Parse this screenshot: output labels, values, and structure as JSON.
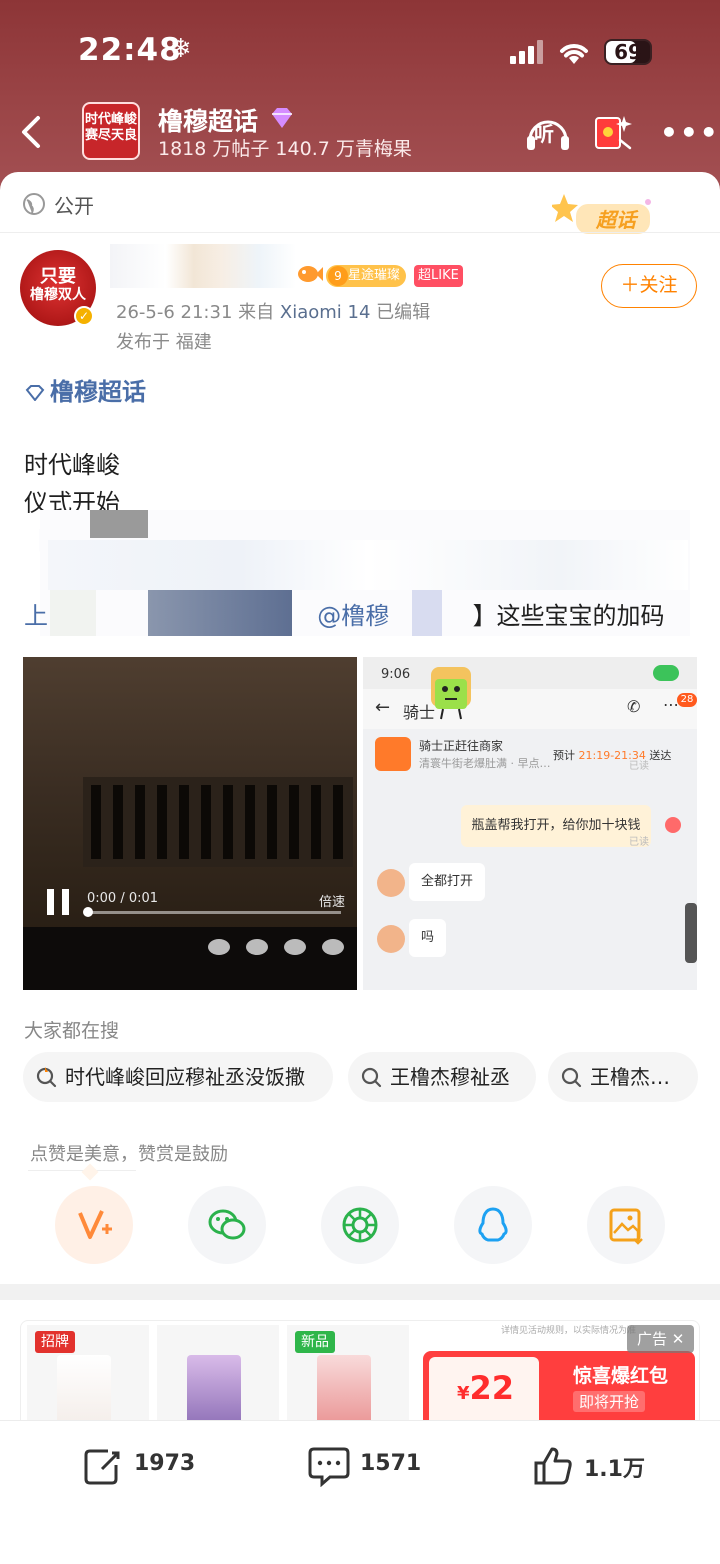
{
  "status_bar": {
    "time": "22:48",
    "battery": "69",
    "battery_level": 0.69
  },
  "header": {
    "logo_text_1": "时代峰峻",
    "logo_text_2": "赛尽天良",
    "title": "橹穆超话",
    "subtitle": "1818 万帖子 140.7 万青梅果",
    "listen_label": "听"
  },
  "post": {
    "visibility": "公开",
    "badge_text": "超话",
    "avatar_text_1": "只要",
    "avatar_text_2": "橹穆双人",
    "level_num": "9",
    "level_label": "星途璀璨",
    "like_badge": "超LIKE",
    "time": "26-5-6 21:31",
    "source_prefix": "来自",
    "device": "Xiaomi 14",
    "edited": "已编辑",
    "location": "发布于 福建",
    "follow_label": "＋关注",
    "topic": "橹穆超话",
    "line1": "时代峰峻",
    "line2": "仪式开始",
    "line3_start": "【@",
    "line5_start": "上",
    "line5_mention": "@橹穆",
    "line5_rest": "】这些宝宝的加码"
  },
  "video": {
    "time": "0:00 / 0:01",
    "speed_label": "倍速",
    "progress": 0.0
  },
  "chat_screenshot": {
    "time": "9:06",
    "contact": "骑士",
    "unread": "28",
    "order_title": "骑士正赶往商家",
    "order_sub": "清寰牛街老爆肚满 · 早点…",
    "eta_prefix": "预计",
    "eta": "21:19-21:34",
    "eta_suffix": "送达",
    "read_1": "已读",
    "my_msg": "瓶盖帮我打开，给你加十块钱",
    "read_2": "已读",
    "reply_1": "全都打开",
    "reply_2": "吗"
  },
  "search": {
    "title": "大家都在搜",
    "chips": [
      "时代峰峻回应穆祉丞没饭撒",
      "王橹杰穆祉丞",
      "王橹杰…"
    ]
  },
  "reward": {
    "hint": "点赞是美意，赞赏是鼓励"
  },
  "ad": {
    "label": "广告 ✕",
    "tag_1": "招牌",
    "tag_2": "新品",
    "amount_prefix": "¥",
    "amount": "22",
    "promo_title": "惊喜爆红包",
    "promo_sub": "即将开抢",
    "fine_print": "详情见活动规则，以实际情况为准"
  },
  "actions": {
    "repost": "1973",
    "comments": "1571",
    "likes": "1.1万"
  },
  "colors": {
    "header": "#9a4446",
    "accent": "#ff8200",
    "link": "#4a6ea8"
  }
}
